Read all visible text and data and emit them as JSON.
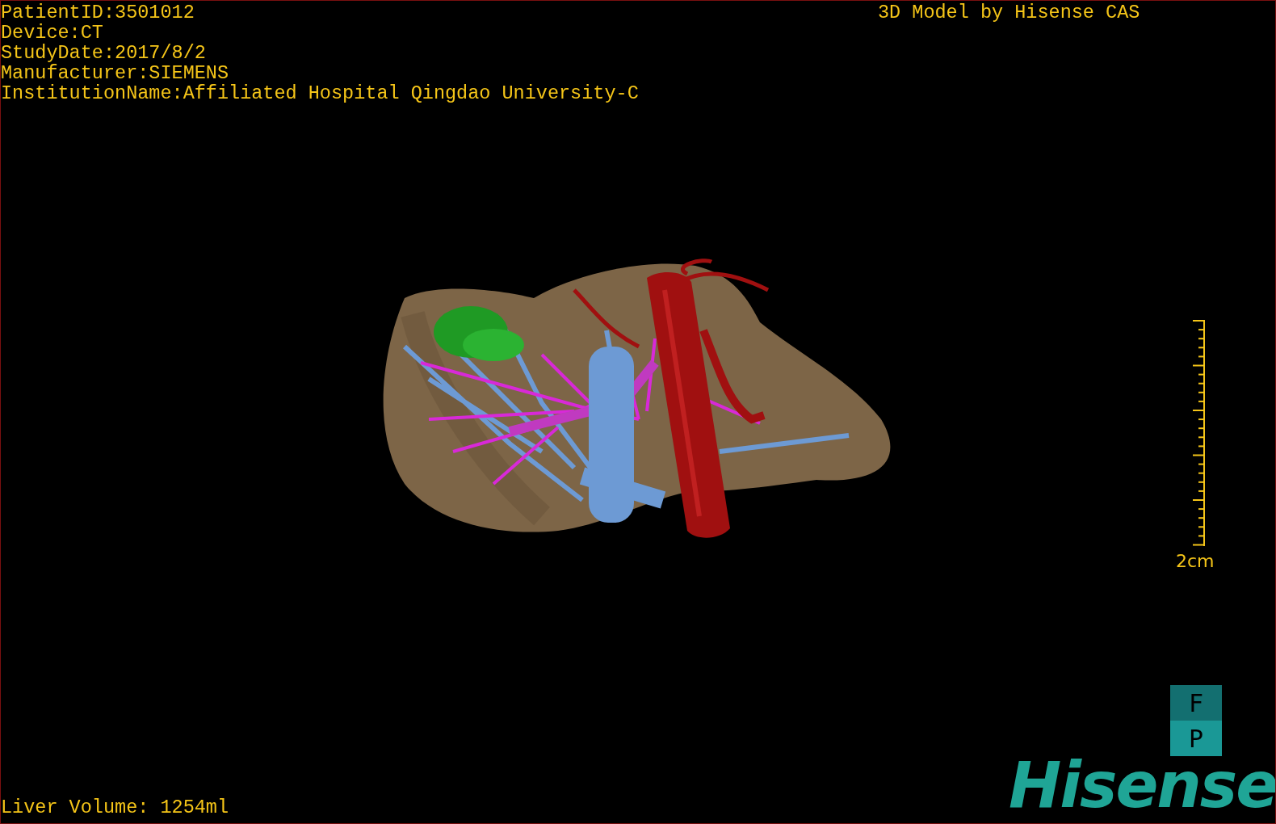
{
  "patient_info": [
    "PatientID:3501012",
    "Device:CT",
    "StudyDate:2017/8/2",
    "Manufacturer:SIEMENS",
    "InstitutionName:Affiliated Hospital Qingdao University-C"
  ],
  "model_credit": "3D Model by Hisense CAS",
  "scale_bar": {
    "label": "2cm"
  },
  "orientation": [
    "F",
    "P"
  ],
  "logo": "Hisense",
  "liver_volume": "Liver Volume: 1254ml"
}
